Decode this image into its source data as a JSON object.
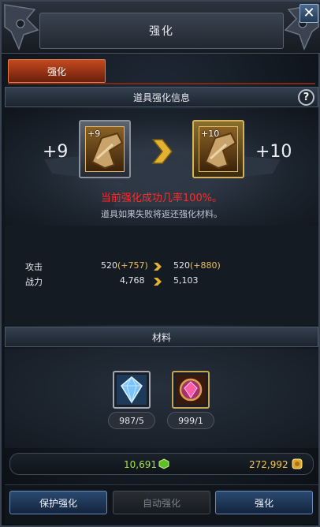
{
  "header": {
    "title": "强化",
    "close_label": "✕"
  },
  "tabs": [
    {
      "label": "强化",
      "active": true
    }
  ],
  "info_section": {
    "title": "道具强化信息",
    "help_label": "?"
  },
  "upgrade": {
    "from_level": "+9",
    "to_level": "+10",
    "from_item_badge": "+9",
    "to_item_badge": "+10",
    "success_rate_text": "当前强化成功几率100%。",
    "fail_note": "道具如果失败将返还强化材料。"
  },
  "stats": [
    {
      "label": "攻击",
      "current": "520",
      "current_bonus": "(+757)",
      "next": "520",
      "next_bonus": "(+880)"
    },
    {
      "label": "战力",
      "current": "4,768",
      "current_bonus": "",
      "next": "5,103",
      "next_bonus": ""
    }
  ],
  "materials_section": {
    "title": "材料"
  },
  "materials": [
    {
      "icon": "blue-crystal-icon",
      "count": "987/5"
    },
    {
      "icon": "red-gem-icon",
      "count": "999/1"
    }
  ],
  "currency": {
    "green_value": "10,691",
    "gold_value": "272,992",
    "green_color": "#a4e04a",
    "gold_color": "#f0c64a"
  },
  "buttons": {
    "protect": "保护强化",
    "auto": "自动强化",
    "enhance": "强化"
  },
  "colors": {
    "tab_active": "#c44a1e",
    "success_text": "#ff2b2b",
    "bonus_text": "#e9c05a"
  }
}
